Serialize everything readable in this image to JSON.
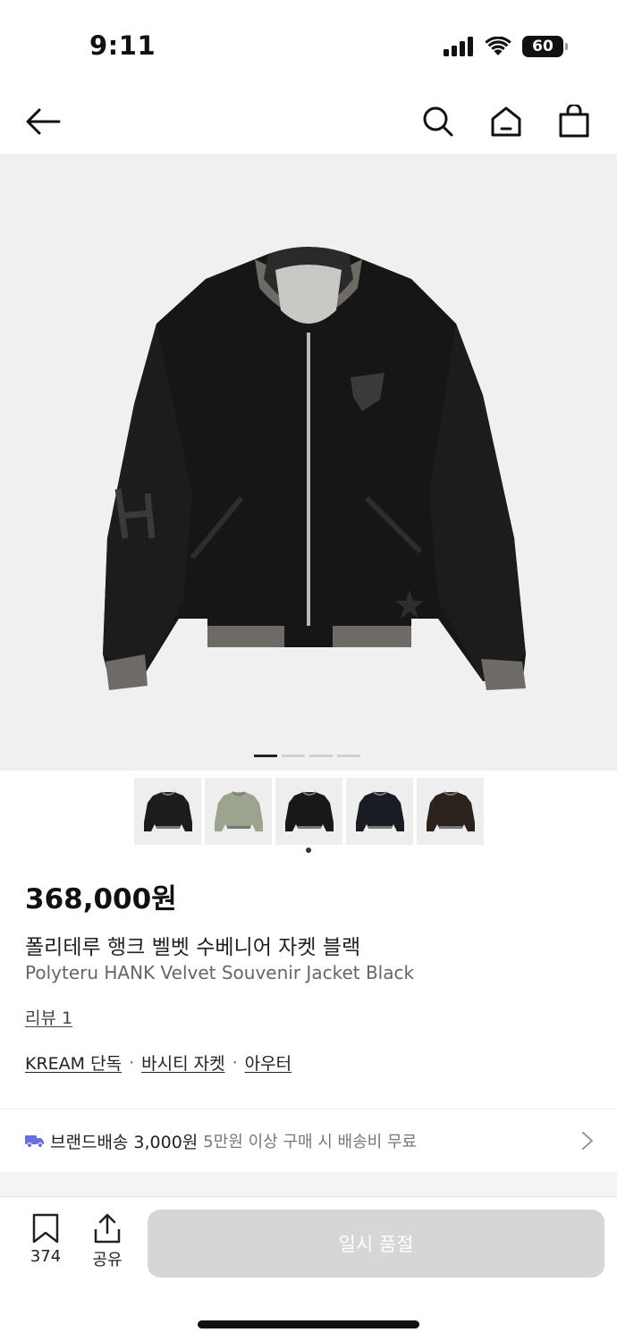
{
  "status_bar": {
    "time": "9:11",
    "battery": "60"
  },
  "header": {
    "back_icon": "back-arrow-icon",
    "search_icon": "search-icon",
    "home_icon": "home-icon",
    "cart_icon": "shopping-bag-icon"
  },
  "gallery": {
    "pages": 4,
    "active_page": 1,
    "thumbnails": [
      {
        "label": "black-jacket",
        "color": "#1c1c1c"
      },
      {
        "label": "sage-jacket",
        "color": "#9aa48f"
      },
      {
        "label": "black-jacket-front",
        "color": "#181818"
      },
      {
        "label": "black-navy-jacket",
        "color": "#1a1c24"
      },
      {
        "label": "dark-brown-jacket",
        "color": "#2b211d"
      }
    ],
    "selected_thumbnail": 3
  },
  "product": {
    "price": "368,000원",
    "name_ko": "폴리테루 행크 벨벳 수베니어 자켓 블랙",
    "name_en": "Polyteru HANK Velvet Souvenir Jacket Black",
    "review": "리뷰 1",
    "tags": [
      "KREAM 단독",
      "바시티 자켓",
      "아우터"
    ],
    "tag_separator": "·"
  },
  "shipping": {
    "label": "브랜드배송",
    "price": "3,000원",
    "note": "5만원 이상 구매 시 배송비 무료",
    "colors": {
      "truck": "#6a6fe0"
    }
  },
  "bottom_bar": {
    "bookmark_count": "374",
    "share_label": "공유",
    "soldout_label": "일시 품절"
  }
}
